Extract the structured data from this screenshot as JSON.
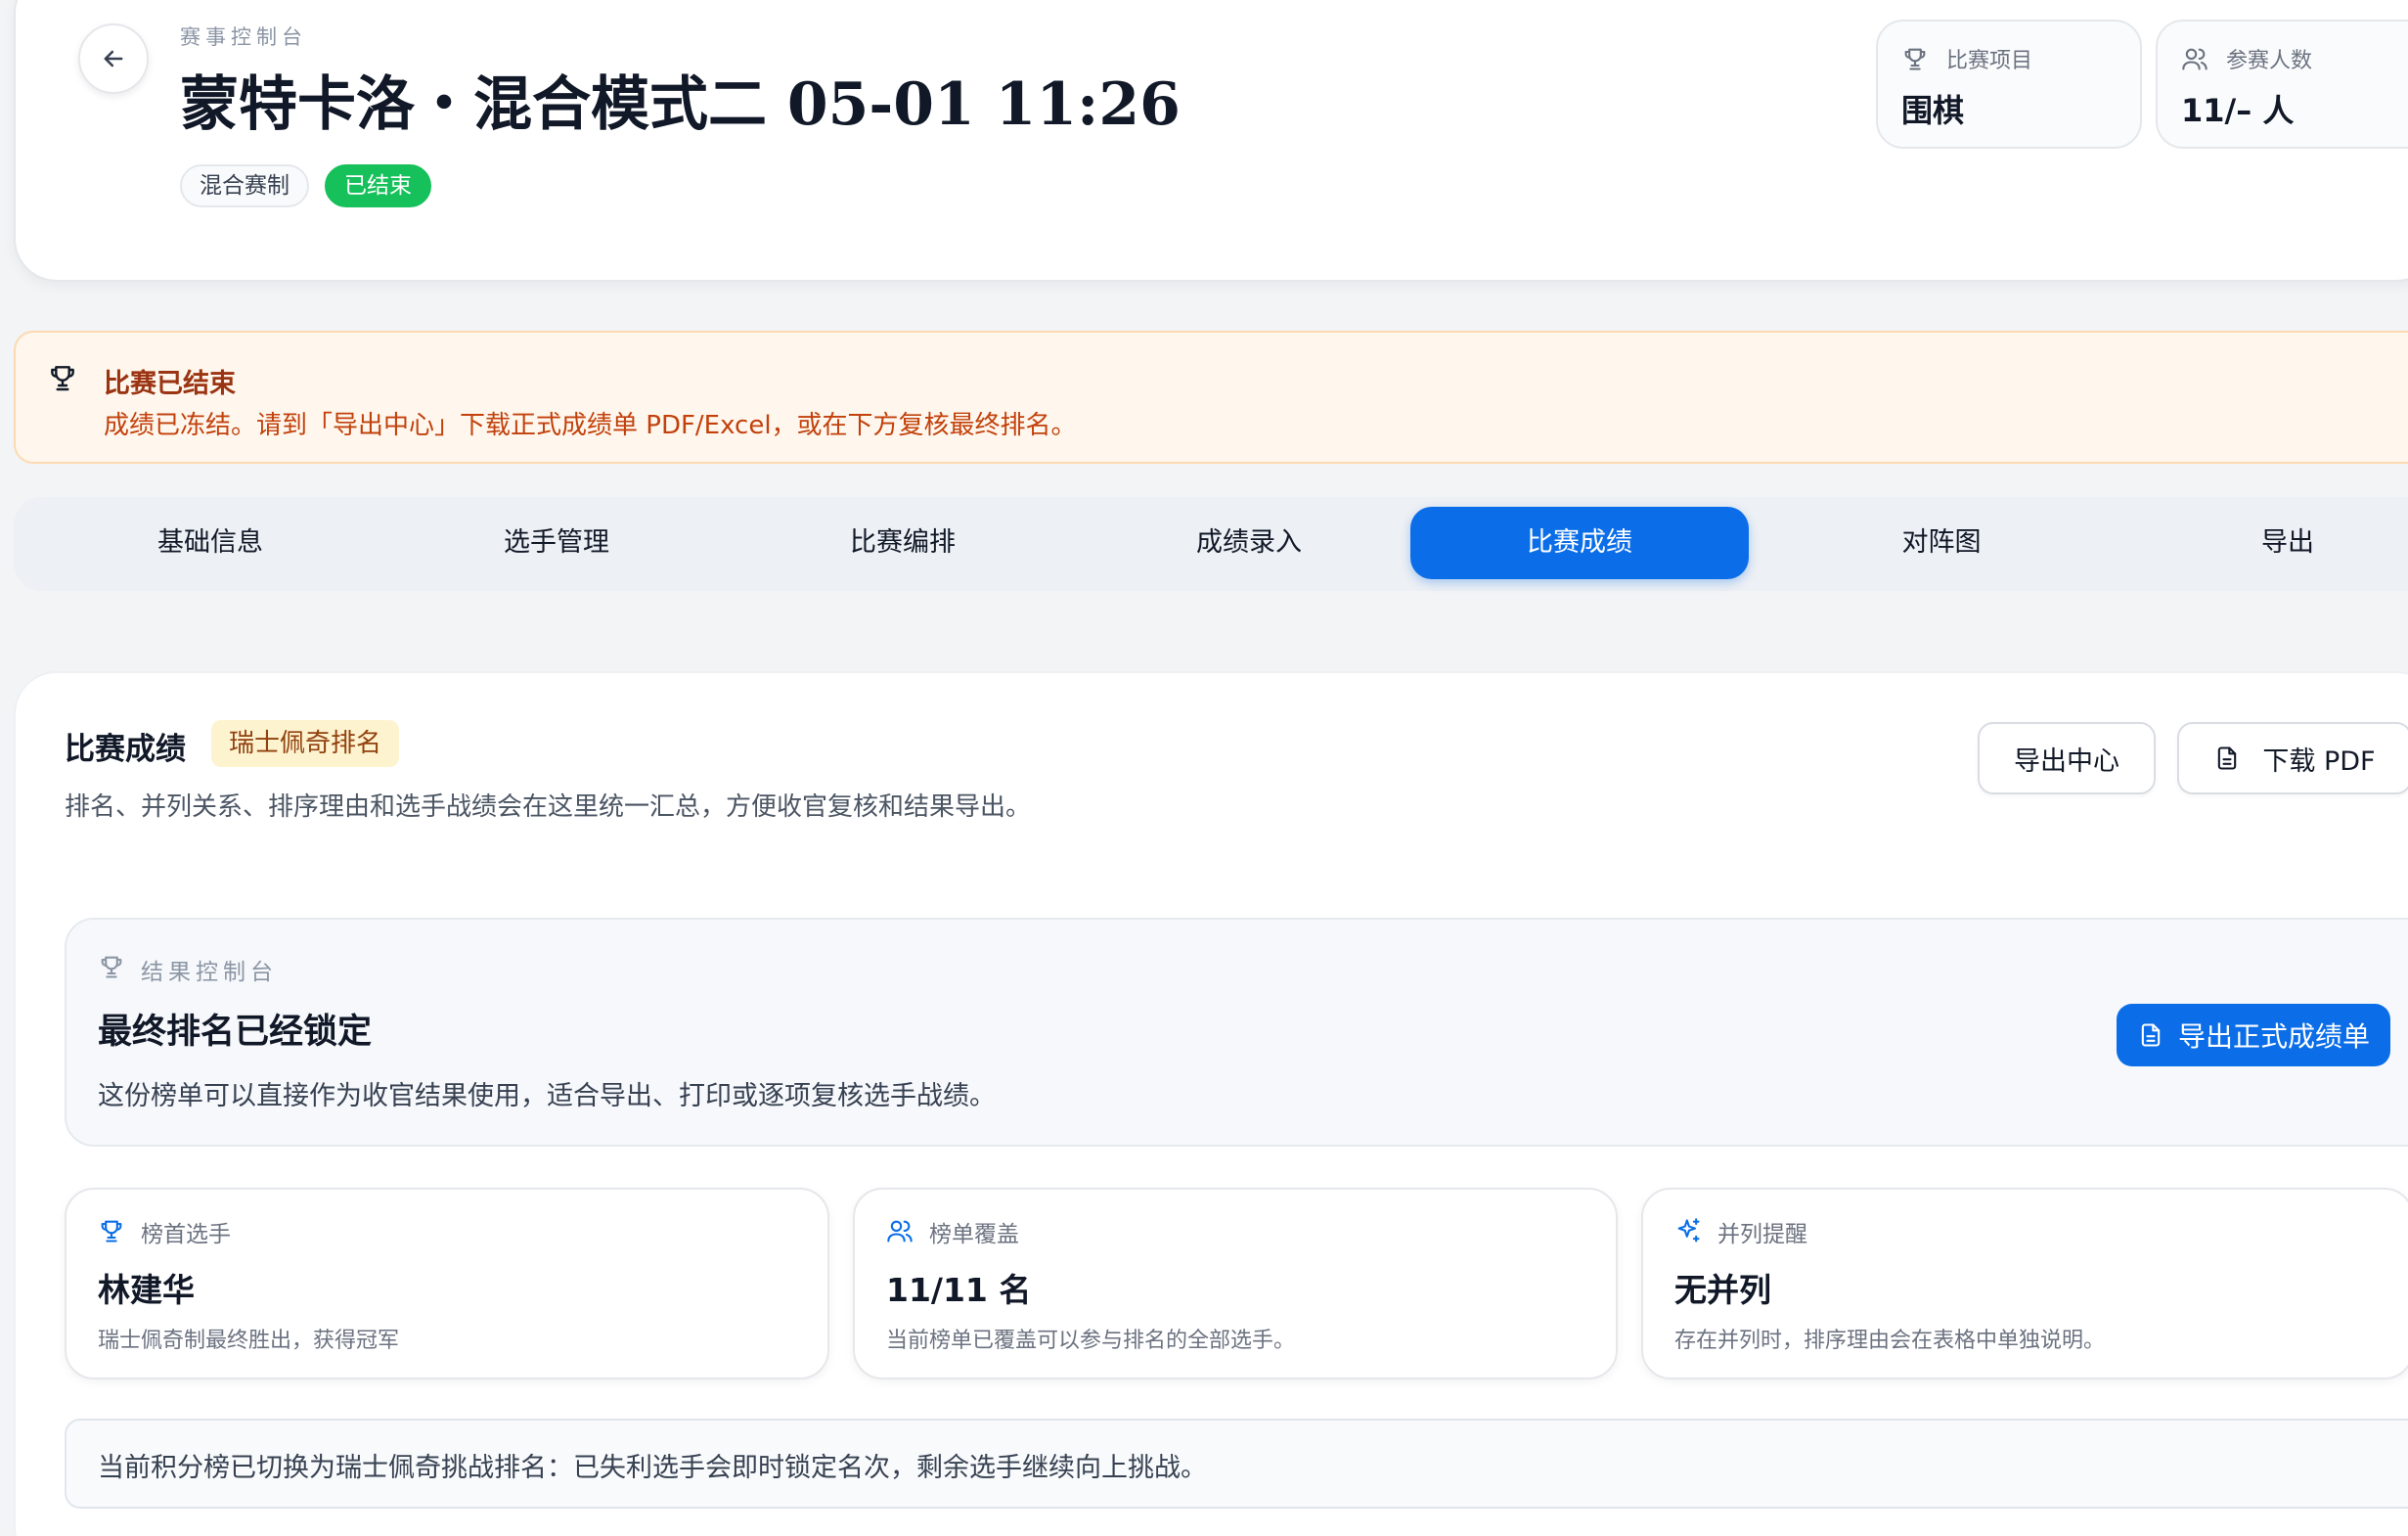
{
  "header": {
    "eyebrow": "赛事控制台",
    "title": "蒙特卡洛・混合模式二 05-01 11:26",
    "badges": {
      "mode": "混合赛制",
      "status": "已结束"
    },
    "stats": [
      {
        "label": "比赛项目",
        "value": "围棋",
        "icon": "trophy-icon"
      },
      {
        "label": "参赛人数",
        "value": "11/– 人",
        "icon": "users-icon"
      }
    ]
  },
  "alert": {
    "icon": "trophy-icon",
    "title": "比赛已结束",
    "description": "成绩已冻结。请到「导出中心」下载正式成绩单 PDF/Excel，或在下方复核最终排名。"
  },
  "tabs": [
    {
      "label": "基础信息",
      "active": false
    },
    {
      "label": "选手管理",
      "active": false
    },
    {
      "label": "比赛编排",
      "active": false
    },
    {
      "label": "成绩录入",
      "active": false
    },
    {
      "label": "比赛成绩",
      "active": true
    },
    {
      "label": "对阵图",
      "active": false
    },
    {
      "label": "导出",
      "active": false
    }
  ],
  "results": {
    "title": "比赛成绩",
    "tag": "瑞士佩奇排名",
    "description": "排名、并列关系、排序理由和选手战绩会在这里统一汇总，方便收官复核和结果导出。",
    "buttons": {
      "export_center": "导出中心",
      "download_pdf": "下载 PDF"
    },
    "console": {
      "eyebrow": "结果控制台",
      "title": "最终排名已经锁定",
      "description": "这份榜单可以直接作为收官结果使用，适合导出、打印或逐项复核选手战绩。",
      "primary_button": "导出正式成绩单"
    },
    "summary": [
      {
        "label": "榜首选手",
        "value": "林建华",
        "description": "瑞士佩奇制最终胜出，获得冠军",
        "icon": "trophy-icon"
      },
      {
        "label": "榜单覆盖",
        "value": "11/11 名",
        "description": "当前榜单已覆盖可以参与排名的全部选手。",
        "icon": "users-icon"
      },
      {
        "label": "并列提醒",
        "value": "无并列",
        "description": "存在并列时，排序理由会在表格中单独说明。",
        "icon": "sparkles-icon"
      }
    ],
    "note": "当前积分榜已切换为瑞士佩奇挑战排名：已失利选手会即时锁定名次，剩余选手继续向上挑战。"
  },
  "colors": {
    "accent": "#0b6ee8",
    "success": "#16c05a",
    "warning_bg": "#fff7ed",
    "warning_text": "#c2410c",
    "tag_bg": "#fdf3cf"
  }
}
